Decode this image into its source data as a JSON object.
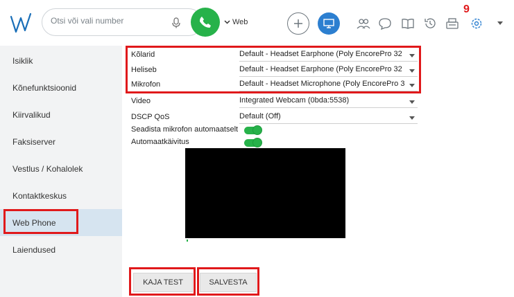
{
  "search": {
    "placeholder": "Otsi või vali number"
  },
  "header": {
    "phone_mode": "Web",
    "notification_count": "9"
  },
  "sidebar": {
    "items": [
      {
        "label": "Isiklik"
      },
      {
        "label": "Kõnefunktsioonid"
      },
      {
        "label": "Kiirvalikud"
      },
      {
        "label": "Faksiserver"
      },
      {
        "label": "Vestlus / Kohalolek"
      },
      {
        "label": "Kontaktkeskus"
      },
      {
        "label": "Web Phone"
      },
      {
        "label": "Laiendused"
      }
    ],
    "active_index": 6
  },
  "settings": {
    "speakers": {
      "label": "Kõlarid",
      "value": "Default - Headset Earphone (Poly EncorePro 32"
    },
    "ringer": {
      "label": "Heliseb",
      "value": "Default - Headset Earphone (Poly EncorePro 32"
    },
    "microphone": {
      "label": "Mikrofon",
      "value": "Default - Headset Microphone (Poly EncorePro 3"
    },
    "video": {
      "label": "Video",
      "value": "Integrated Webcam (0bda:5538)"
    },
    "dscp": {
      "label": "DSCP QoS",
      "value": "Default (Off)"
    },
    "auto_mic": {
      "label": "Seadista mikrofon automaatselt",
      "enabled": true
    },
    "autostart": {
      "label": "Automaatkäivitus",
      "enabled": true
    }
  },
  "buttons": {
    "test": "KAJA TEST",
    "save": "SALVESTA"
  },
  "colors": {
    "accent_green": "#27b24a",
    "accent_blue": "#2c7fd0",
    "highlight_red": "#e0191b",
    "badge_red": "#e0191b"
  }
}
